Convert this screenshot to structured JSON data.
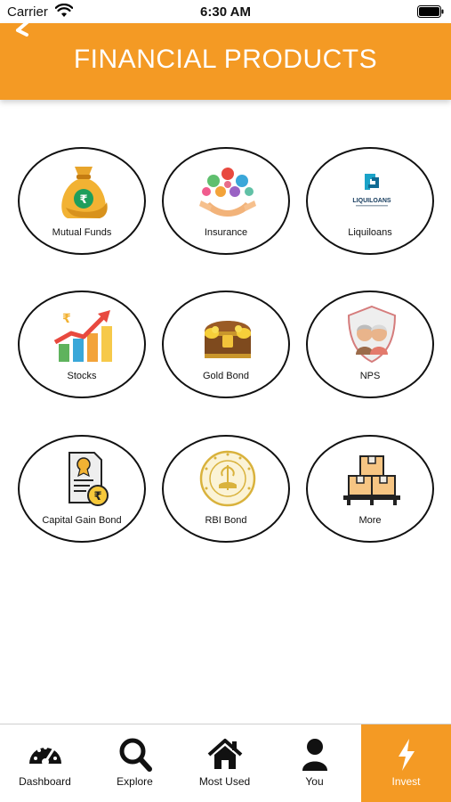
{
  "status_bar": {
    "carrier": "Carrier",
    "time": "6:30 AM"
  },
  "header": {
    "title": "FINANCIAL PRODUCTS"
  },
  "products": [
    {
      "label": "Mutual Funds",
      "icon": "money-bag-icon"
    },
    {
      "label": "Insurance",
      "icon": "insurance-icon"
    },
    {
      "label": "Liquiloans",
      "icon": "liquiloans-logo",
      "logo_text": "LIQUILOANS"
    },
    {
      "label": "Stocks",
      "icon": "stocks-chart-icon"
    },
    {
      "label": "Gold Bond",
      "icon": "treasure-chest-icon"
    },
    {
      "label": "NPS",
      "icon": "pension-shield-icon"
    },
    {
      "label": "Capital Gain Bond",
      "icon": "bond-certificate-icon"
    },
    {
      "label": "RBI Bond",
      "icon": "rbi-seal-icon"
    },
    {
      "label": "More",
      "icon": "boxes-icon"
    }
  ],
  "tabs": [
    {
      "label": "Dashboard",
      "icon": "speedometer-icon"
    },
    {
      "label": "Explore",
      "icon": "search-icon"
    },
    {
      "label": "Most Used",
      "icon": "home-icon"
    },
    {
      "label": "You",
      "icon": "user-icon"
    },
    {
      "label": "Invest",
      "icon": "lightning-icon",
      "active": true
    }
  ],
  "colors": {
    "accent": "#f49a24",
    "header_text": "#ffffff",
    "tile_border": "#111111"
  }
}
